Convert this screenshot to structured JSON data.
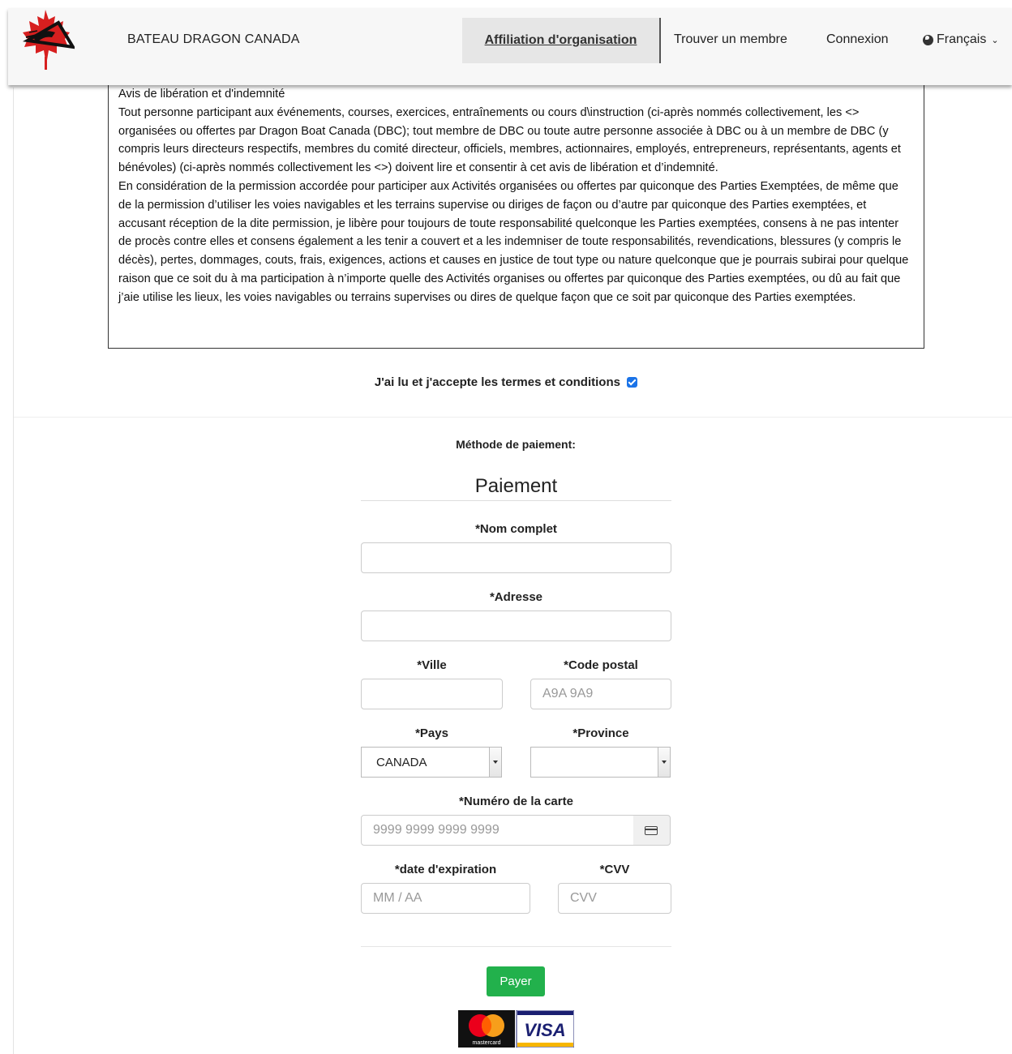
{
  "header": {
    "brand": "BATEAU DRAGON CANADA",
    "nav": {
      "active": "Affiliation d'organisation",
      "find_member": "Trouver un membre",
      "login": "Connexion",
      "language": "Français"
    }
  },
  "terms": {
    "heading": "Avis de libération et d'indemnité",
    "paragraph1": "Tout personne participant aux événements, courses, exercices, entraînements ou cours d\\instruction (ci-après nommés collectivement, les <> organisées ou offertes par Dragon Boat Canada (DBC); tout membre de DBC ou toute autre personne associée à DBC ou à un membre de DBC (y compris leurs directeurs respectifs, membres du comité directeur, officiels, membres, actionnaires, employés, entrepreneurs, représentants, agents et bénévoles) (ci-après nommés collectivement les <>) doivent lire et consentir à cet avis de libération et d’indemnité.",
    "paragraph2": "En considération de la permission accordée pour participer aux Activités organisées ou offertes par quiconque des Parties Exemptées, de même que de la permission d’utiliser les voies navigables et les terrains supervise ou diriges de façon ou d’autre par quiconque des Parties exemptées, et accusant réception de la dite permission, je libère pour toujours de toute responsabilité quelconque les Parties exemptées, consens à ne pas intenter de procès contre elles et consens également a les tenir a couvert et a les indemniser de toute responsabilités, revendications, blessures (y compris le décès), pertes, dommages, couts, frais, exigences, actions et causes en justice de tout type ou nature quelconque que je pourrais subirai pour quelque raison que ce soit du à ma participation à n’importe quelle des Activités organises ou offertes par quiconque des Parties exemptées, ou dû au fait que j’aie utilise les lieux, les voies navigables ou terrains supervises ou dires de quelque façon que ce soit par quiconque des Parties exemptées."
  },
  "agree_label": "J'ai lu et j'accepte les termes et conditions",
  "agree_checked": true,
  "payment_method_label": "Méthode de paiement:",
  "payment": {
    "title": "Paiement",
    "full_name_label": "*Nom complet",
    "full_name_value": "",
    "address_label": "*Adresse",
    "address_value": "",
    "city_label": "*Ville",
    "postal_label": "*Code postal",
    "postal_placeholder": "A9A 9A9",
    "country_label": "*Pays",
    "country_value": "CANADA",
    "province_label": "*Province",
    "province_value": "",
    "card_label": "*Numéro de la carte",
    "card_placeholder": "9999 9999 9999 9999",
    "expiry_label": "*date d'expiration",
    "expiry_placeholder": "MM / AA",
    "cvv_label": "*CVV",
    "cvv_placeholder": "CVV",
    "submit": "Payer"
  },
  "card_brands": {
    "mastercard": "mastercard",
    "visa": "VISA"
  },
  "colors": {
    "pay_button": "#22b14c",
    "logo_red": "#d71f1f",
    "checkbox": "#1a73e8",
    "visa_blue": "#1a1f71",
    "visa_gold": "#f7b600"
  }
}
